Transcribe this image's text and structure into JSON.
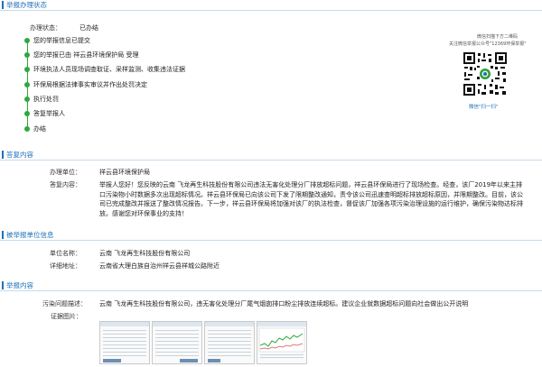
{
  "status_section": {
    "title": "举报办理状态",
    "status_label": "办理状态：",
    "status_value": "已办结",
    "steps": [
      "您的举报信息已提交",
      "您的举报已由  祥云县环境保护局 受理",
      "环境执法人员现场调查取证、采样监测、收集违法证据",
      "环保局根据法律事实审议并作出处罚决定",
      "执行处罚",
      "答复举报人",
      "办结"
    ],
    "qr_caption_1": "微信扫描下方二维码",
    "qr_caption_2": "关注微信举报公众号\"12369环保举报\"",
    "scan_text": "微信\"扫一扫\""
  },
  "reply_section": {
    "title": "答复内容",
    "unit_label": "办理单位：",
    "unit_value": "祥云县环境保护局",
    "content_label": "答复内容：",
    "content_text": "举报人您好！您反映的云南        飞龙再生科技股份有限公司违法无害化处理分厂排放超标问题，祥云县环保局进行了现场检查。经查，该厂2019年以来主排口污染物小时数据多次出现超标情况。祥云县环保局已向该公司下发了限期整改通知，责令该公司迅速查明超标排放超标原因，并限期整改。目前，该公司已完成整改并报送了整改情况报告。下一步，祥云县环保局将加强对该厂的执法检查，督促该厂加强各项污染治理设施的运行维护，确保污染物达标排放。感谢您对环保事业的支持！"
  },
  "reported_section": {
    "title": "被举报单位信息",
    "unit_label": "单位名称：",
    "unit_value": "云南        飞龙再生科技股份有限公司",
    "address_label": "详细地址：",
    "address_value": "云南省大理白族自治州祥云县祥城公路附近"
  },
  "report_section": {
    "title": "举报内容",
    "problem_label": "污染问题描述：",
    "problem_value": "云南        飞龙再生科技股份有限公司，违无害化处理分厂尾气烟囱排口粉尘排放连续超标。建议企业就数据超标问题向社会做出公开说明",
    "evidence_label": "证据图片："
  },
  "colors": {
    "accent_blue": "#1f6fb8",
    "timeline_green": "#2ea83f"
  }
}
